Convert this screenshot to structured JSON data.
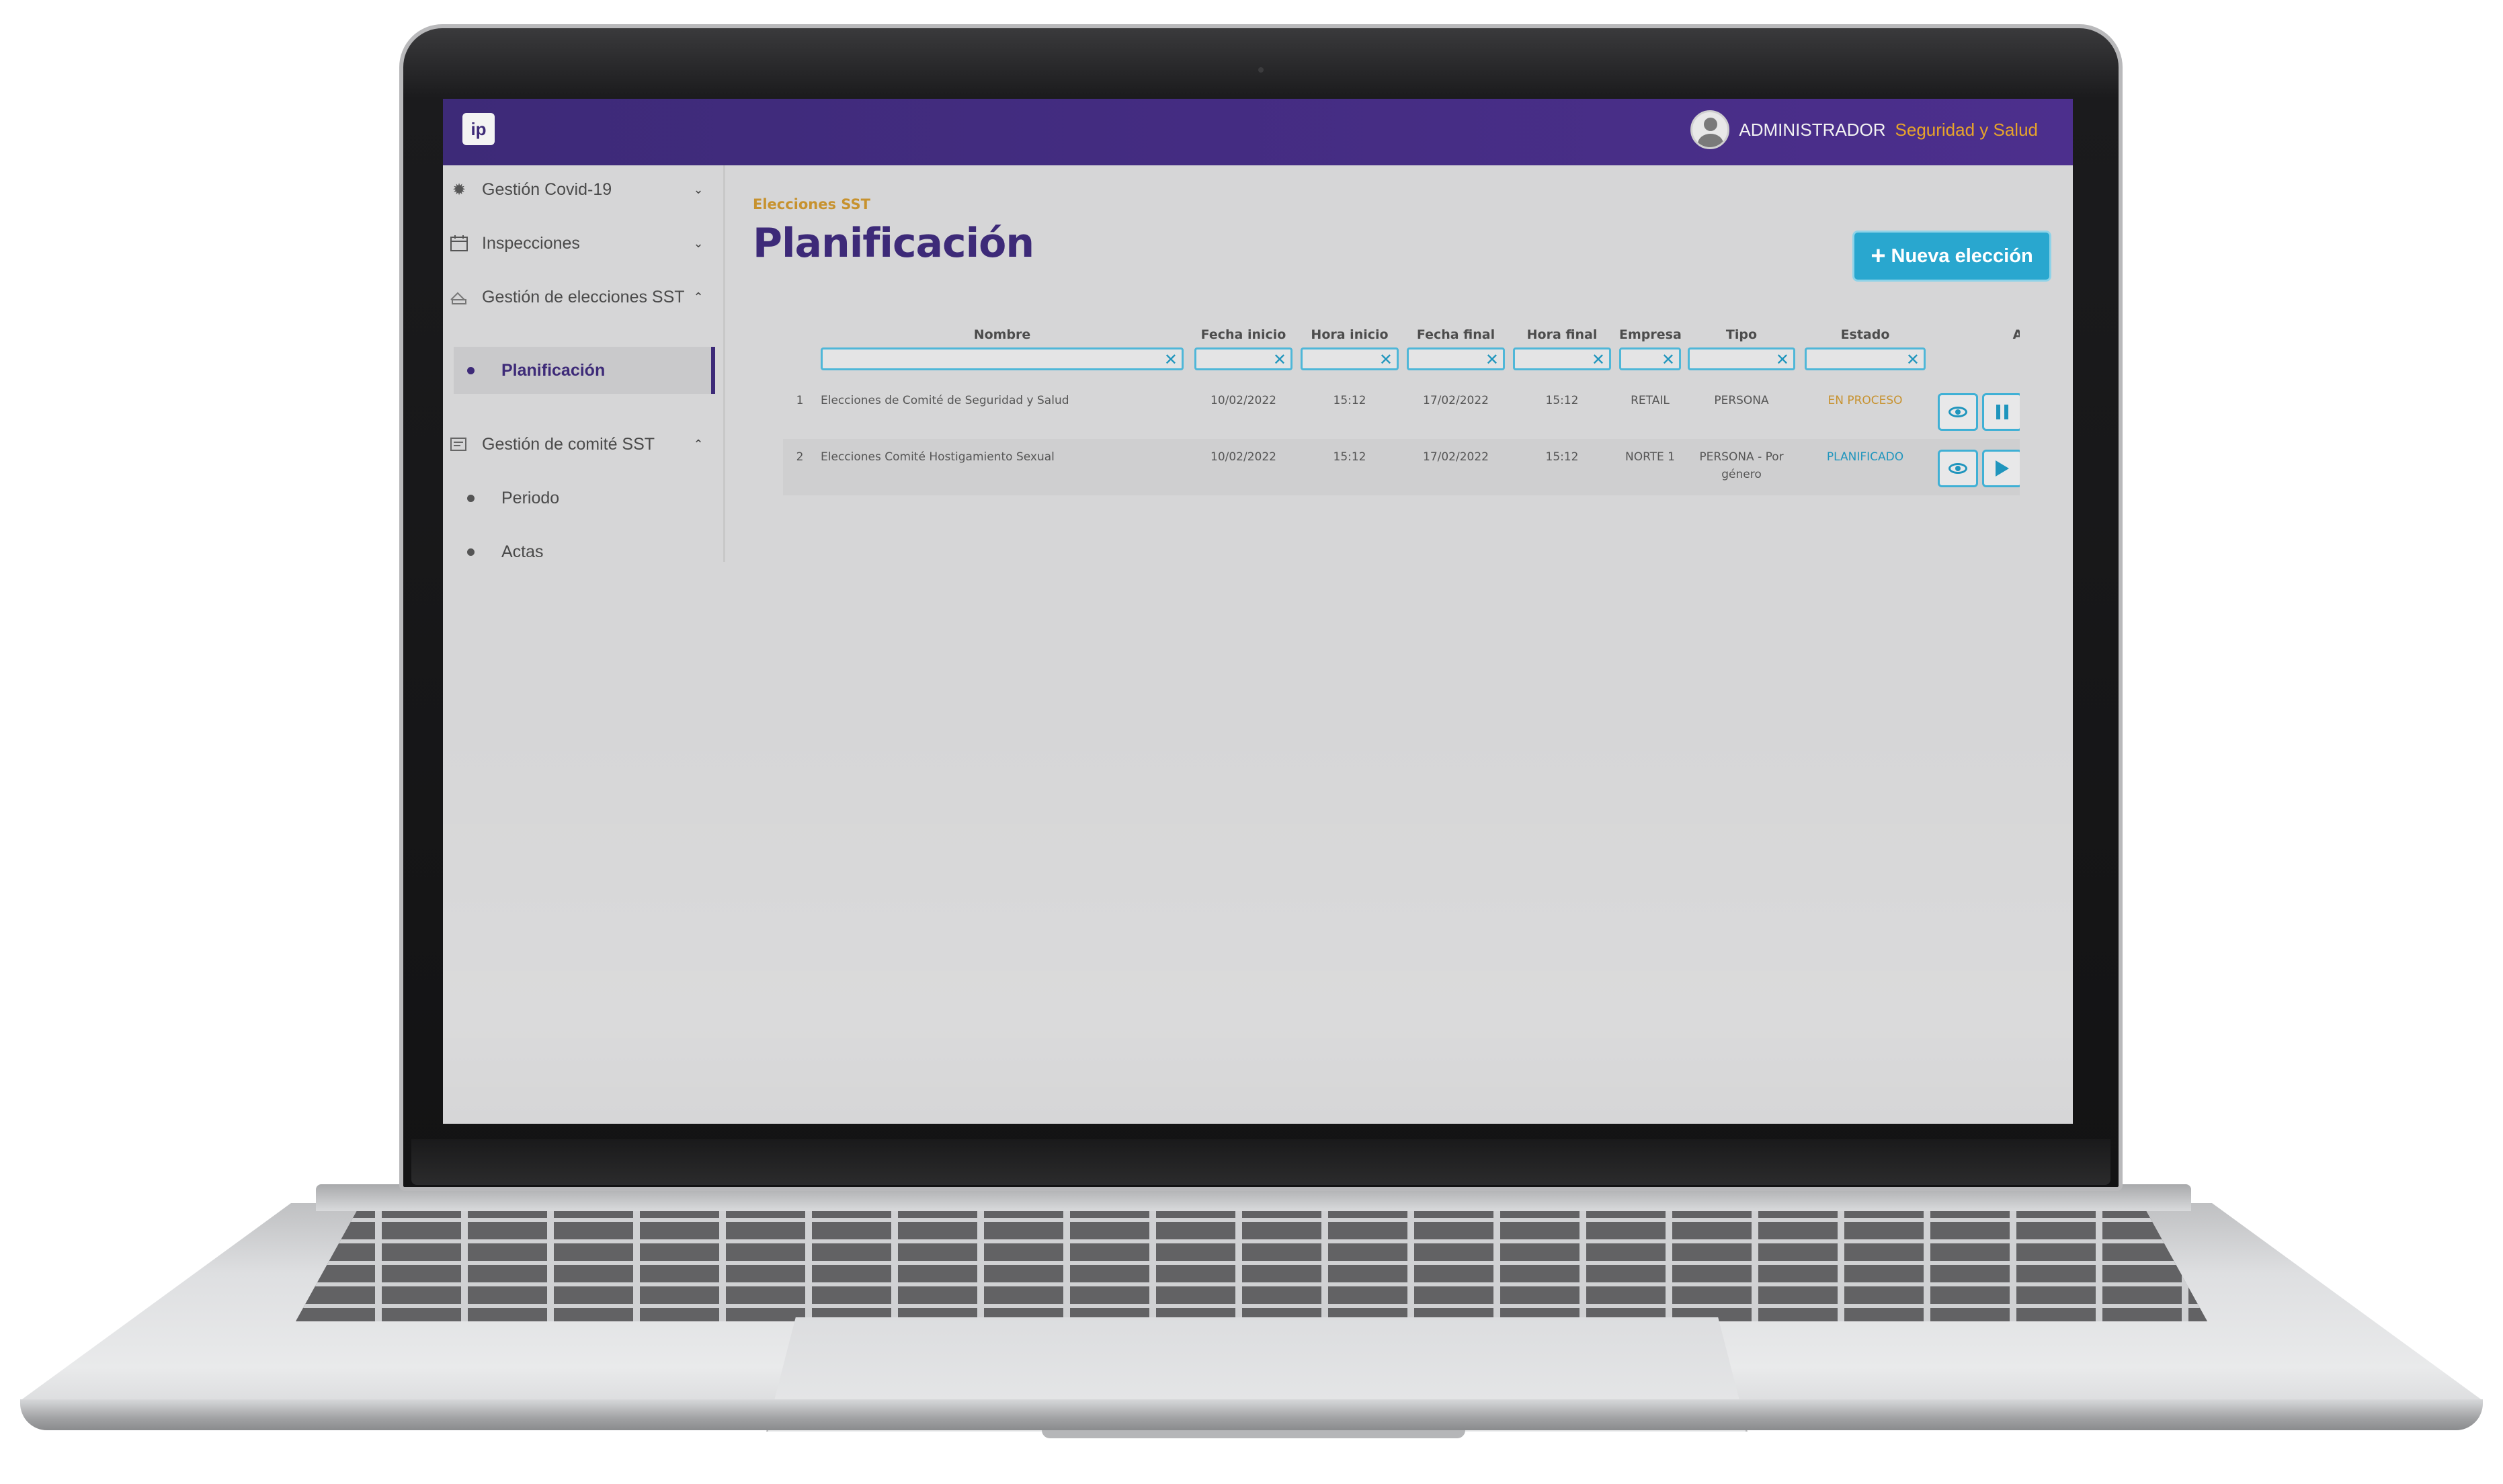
{
  "app": {
    "logo_text": "ip",
    "user": {
      "name": "ADMINISTRADOR",
      "role": "Seguridad y Salud"
    }
  },
  "sidebar": {
    "items": [
      {
        "label": "Gestión Covid-19",
        "icon": "virus-icon",
        "expanded": false
      },
      {
        "label": "Inspecciones",
        "icon": "calendar-icon",
        "expanded": false
      },
      {
        "label": "Gestión de elecciones SST",
        "icon": "ballot-icon",
        "expanded": true,
        "children": [
          {
            "label": "Planificación",
            "active": true
          }
        ]
      },
      {
        "label": "Gestión de comité SST",
        "icon": "committee-icon",
        "expanded": true,
        "children": [
          {
            "label": "Periodo"
          },
          {
            "label": "Actas"
          }
        ]
      }
    ]
  },
  "main": {
    "breadcrumb": "Elecciones SST",
    "title": "Planificación",
    "new_button": "Nueva elección",
    "table": {
      "columns": [
        "Nombre",
        "Fecha inicio",
        "Hora inicio",
        "Fecha final",
        "Hora final",
        "Empresa",
        "Tipo",
        "Estado",
        "A"
      ],
      "rows": [
        {
          "num": "1",
          "nombre": "Elecciones de Comité de Seguridad y Salud",
          "fecha_inicio": "10/02/2022",
          "hora_inicio": "15:12",
          "fecha_final": "17/02/2022",
          "hora_final": "15:12",
          "empresa": "RETAIL",
          "tipo": "PERSONA",
          "estado": "EN PROCESO"
        },
        {
          "num": "2",
          "nombre": "Elecciones Comité Hostigamiento Sexual",
          "fecha_inicio": "10/02/2022",
          "hora_inicio": "15:12",
          "fecha_final": "17/02/2022",
          "hora_final": "15:12",
          "empresa": "NORTE 1",
          "tipo": "PERSONA - Por género",
          "estado": "PLANIFICADO"
        }
      ]
    }
  },
  "colors": {
    "brand_purple": "#3d2a78",
    "accent_gold": "#c7922f",
    "accent_cyan": "#29a7cf"
  }
}
